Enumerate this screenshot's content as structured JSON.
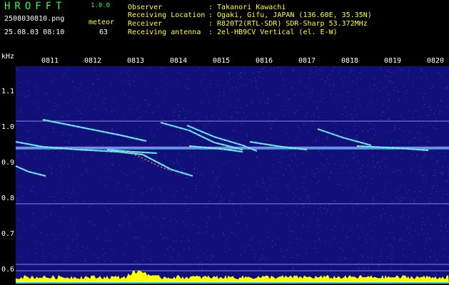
{
  "app": {
    "logo": "HROFFT",
    "version": "1.0.0",
    "filename": "2508030810.png",
    "timestamp": "25.08.03 08:10",
    "count_label": "meteor",
    "count_value": "63"
  },
  "info": {
    "rows": [
      {
        "label": "Observer",
        "value": ": Takanori Kawachi"
      },
      {
        "label": "Receiving Location",
        "value": ": Ogaki, Gifu, JAPAN (136.60E, 35.35N)"
      },
      {
        "label": "Receiver",
        "value": ": R820T2(RTL-SDR) SDR-Sharp 53.372MHz"
      },
      {
        "label": "Receiving antenna",
        "value": ": 2el-HB9CV Vertical (el. E-W)"
      }
    ]
  },
  "axis": {
    "unit": "kHz",
    "y_ticks": [
      "1.1",
      "1.0",
      "0.9",
      "0.8",
      "0.7",
      "0.6"
    ],
    "x_ticks": [
      "0811",
      "0812",
      "0813",
      "0814",
      "0815",
      "0816",
      "0817",
      "0818",
      "0819",
      "0820"
    ]
  },
  "colors": {
    "background": "#000000",
    "spectrum_base": "#101078",
    "reference_line": "#9a9aff",
    "signal": "#55e0ff",
    "histogram": "#ffff00",
    "header_green": "#33ff33",
    "header_yellow": "#ffff33"
  }
}
